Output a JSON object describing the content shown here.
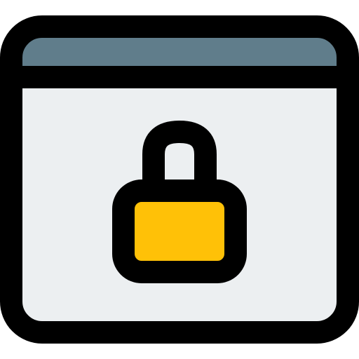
{
  "icon": {
    "name": "secure-browser-lock-icon",
    "colors": {
      "outline": "#000000",
      "title_bar": "#607D8B",
      "window_body": "#ECEFF1",
      "lock_body": "#FFC107"
    }
  }
}
